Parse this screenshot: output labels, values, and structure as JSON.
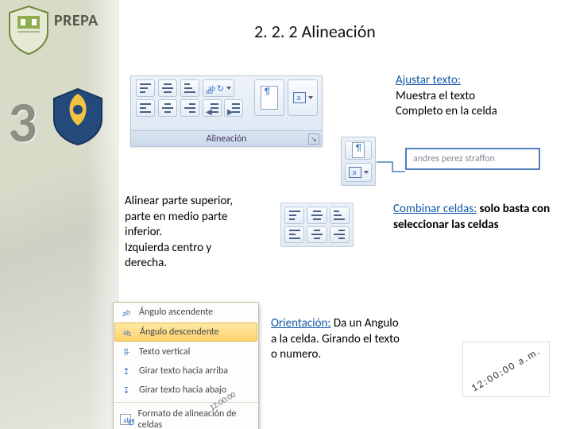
{
  "sidebar": {
    "brand": "PREPA",
    "number": "3"
  },
  "title": "2. 2. 2 Alineación",
  "ribbon_group_label": "Alineación",
  "callouts": {
    "ajustar": {
      "heading": "Ajustar texto:",
      "line1": " Muestra el texto",
      "line2": "Completo en la celda"
    },
    "alinear": {
      "line1": "Alinear parte superior,",
      "line2": "parte en medio parte",
      "line3": "inferior.",
      "line4": "Izquierda centro y",
      "line5": "derecha."
    },
    "combinar": {
      "heading": "Combinar celdas:",
      "rest": " solo basta con seleccionar las celdas"
    },
    "orientacion": {
      "heading": "Orientación:",
      "rest": " Da un Angulo a la celda. Girando el texto  o numero."
    }
  },
  "name_sample": "andres perez straffon",
  "orientation_menu": {
    "items": [
      "Ángulo ascendente",
      "Ángulo descendente",
      "Texto vertical",
      "Girar texto hacia arriba",
      "Girar texto hacia abajo",
      "Formato de alineación de celdas"
    ],
    "selected_index": 1
  },
  "rotated_time": "12:00:00 a.m.",
  "rotated_time_small": "12:00:00"
}
